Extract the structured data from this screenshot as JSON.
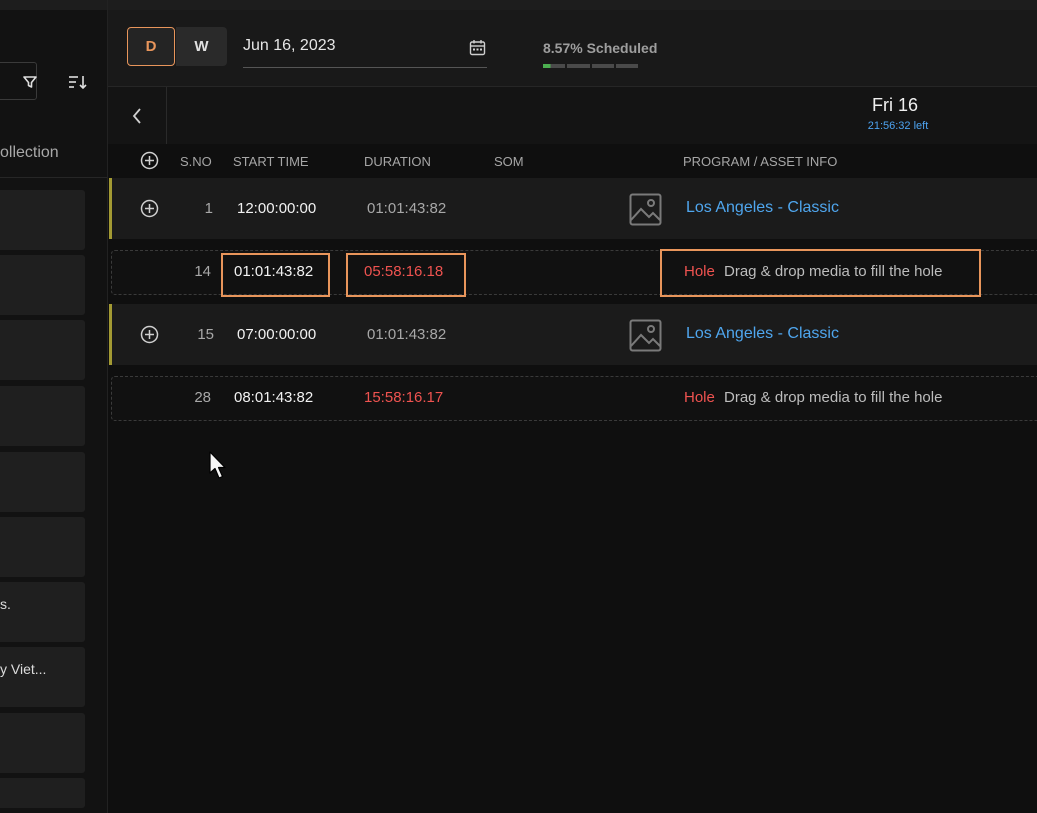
{
  "left_panel": {
    "collection_label": "ollection",
    "cards": [
      "",
      "",
      "",
      "",
      "",
      "",
      "s.",
      "y Viet...",
      "",
      ""
    ]
  },
  "header": {
    "view_toggle": {
      "day": "D",
      "week": "W",
      "active": "D"
    },
    "date": "Jun 16, 2023",
    "scheduled_label": "8.57% Scheduled",
    "scheduled_fraction": 0.0857
  },
  "day_nav": {
    "day_label": "Fri 16",
    "time_left": "21:56:32 left"
  },
  "columns": {
    "sno": "S.NO",
    "start_time": "START TIME",
    "duration": "DURATION",
    "som": "SOM",
    "program": "PROGRAM / ASSET INFO"
  },
  "rows": [
    {
      "type": "program",
      "sno": "1",
      "start": "12:00:00:00",
      "duration": "01:01:43:82",
      "title": "Los Angeles - Classic"
    },
    {
      "type": "hole",
      "sno": "14",
      "start": "01:01:43:82",
      "duration": "05:58:16.18",
      "hole_label": "Hole",
      "hole_msg": "Drag & drop media to fill the hole"
    },
    {
      "type": "program",
      "sno": "15",
      "start": "07:00:00:00",
      "duration": "01:01:43:82",
      "title": "Los Angeles - Classic"
    },
    {
      "type": "hole",
      "sno": "28",
      "start": "08:01:43:82",
      "duration": "15:58:16.17",
      "hole_label": "Hole",
      "hole_msg": "Drag & drop media to fill the hole"
    }
  ],
  "colors": {
    "accent": "#e8955b",
    "link": "#4fa6ee",
    "hole_red": "#ef5350",
    "progress_green": "#4caf50",
    "row_marker": "#a39a33"
  }
}
